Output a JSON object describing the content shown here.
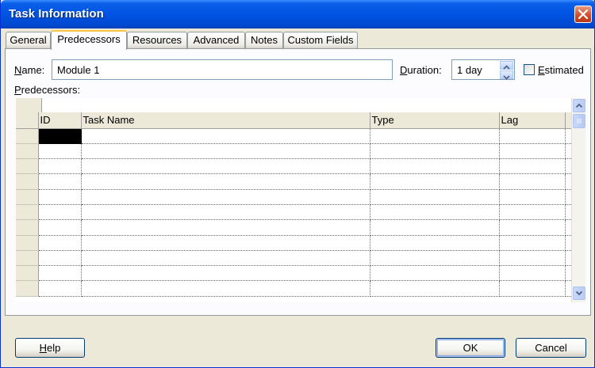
{
  "window": {
    "title": "Task Information"
  },
  "tabs": [
    {
      "label": "General"
    },
    {
      "label": "Predecessors",
      "active": true
    },
    {
      "label": "Resources"
    },
    {
      "label": "Advanced"
    },
    {
      "label": "Notes"
    },
    {
      "label": "Custom Fields"
    }
  ],
  "form": {
    "name_label_key": "N",
    "name_label_rest": "ame:",
    "name_value": "Module 1",
    "duration_label_key": "D",
    "duration_label_rest": "uration:",
    "duration_value": "1 day",
    "estimated_label_key": "E",
    "estimated_label_rest": "stimated",
    "estimated_checked": false
  },
  "predecessors": {
    "label_key": "P",
    "label_rest": "redecessors:",
    "columns": [
      "ID",
      "Task Name",
      "Type",
      "Lag"
    ],
    "row_count": 11
  },
  "buttons": {
    "help_key": "H",
    "help_rest": "elp",
    "ok": "OK",
    "cancel": "Cancel"
  },
  "colors": {
    "titlebar": "#0054E3",
    "dialog_bg": "#ECE9D8",
    "active_tab_highlight": "#F7C444"
  }
}
